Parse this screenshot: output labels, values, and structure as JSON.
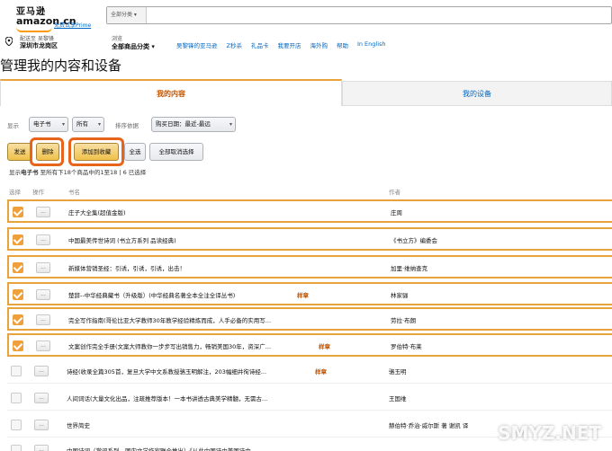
{
  "header": {
    "logo_cn": "亚马逊",
    "logo_en": "amazon.cn",
    "prime_link": "免费试享Prime",
    "search_category": "全部分类",
    "deliver_to_label": "配送至",
    "deliver_to_name": "吴黎锋",
    "deliver_to_city": "深圳市龙岗区",
    "browse_label": "浏览",
    "browse_value": "全部商品分类",
    "nav_links": [
      "吴黎锋的亚马逊",
      "Z秒杀",
      "礼品卡",
      "我要开店",
      "海外购",
      "帮助",
      "In English"
    ]
  },
  "page_title": "管理我的内容和设备",
  "tabs": [
    {
      "label": "我的内容",
      "active": true
    },
    {
      "label": "我的设备",
      "active": false
    }
  ],
  "filters": {
    "show_label": "显示",
    "type_value": "电子书",
    "scope_value": "所有",
    "sort_label": "排序依据",
    "sort_value": "购买日期：最近-最远"
  },
  "actions": {
    "send": "发送",
    "delete": "删除",
    "add_to_collection": "添加到收藏",
    "select_all": "全选",
    "deselect_all": "全部取消选择"
  },
  "summary": {
    "prefix": "显示",
    "type": "电子书",
    "text": "至所有下18个商品中的1至18 | 6 已选择"
  },
  "table": {
    "headers": {
      "select": "选择",
      "action": "操作",
      "title": "书名",
      "author": "作者"
    },
    "rows": [
      {
        "title": "庄子大全集(超值金版)",
        "tag": "",
        "author": "庄周",
        "selected": true
      },
      {
        "title": "中国最美传世诗词 (书立方系列 品读经典)",
        "tag": "",
        "author": "《书立方》编委会",
        "selected": true
      },
      {
        "title": "新媒体营销圣经：引诱，引诱，引诱，出击！",
        "tag": "",
        "author": "加里·维纳查克",
        "selected": true
      },
      {
        "title": "楚辞--中华经典藏书（升级版）(中华经典名著全本全注全译丛书)",
        "tag": "样章",
        "author": "林家骊",
        "selected": true
      },
      {
        "title": "完全写作指南(哥伦比亚大学教师30年教学经验精炼而成，人手必备的实用写...",
        "tag": "",
        "author": "劳拉·布朗",
        "selected": true
      },
      {
        "title": "文案创作完全手册(文案大师教你一步步写出销售力，畅销美国30年，资深广...",
        "tag": "样章",
        "author": "罗伯特·布莱",
        "selected": true
      },
      {
        "title": "诗经(收录全篇305首，复旦大学中文系教授骆玉明解注，203幅细井徇诗经...",
        "tag": "样章",
        "author": "骆玉明",
        "selected": false
      },
      {
        "title": "人间词话(大量文化出品，注疏推荐版本！一本书讲透古典美学精髓，无需古...",
        "tag": "",
        "author": "王国维",
        "selected": false
      },
      {
        "title": "世界简史",
        "tag": "",
        "author": "赫伯特·乔治·威尔斯 著 谢凯 译",
        "selected": false
      },
      {
        "title": "中国诗词（掌阅系列，国内文学作家联合推出）《从此中国诗中美国诗中...",
        "tag": "",
        "author": "",
        "selected": false
      }
    ],
    "action_glyph": "..."
  },
  "watermark": "SMYZ.NET",
  "colors": {
    "accent": "#e8a33a",
    "highlight": "#e8641b",
    "link": "#0066c0",
    "tag": "#c45500"
  }
}
